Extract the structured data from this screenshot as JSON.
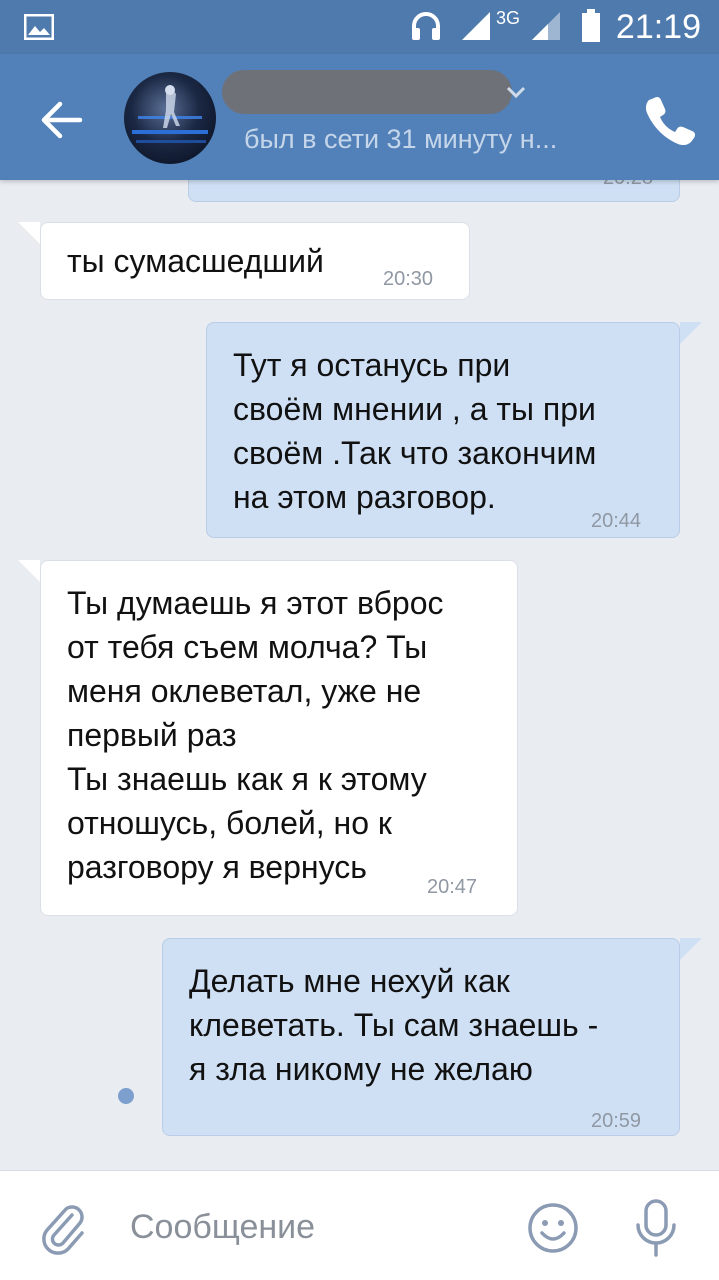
{
  "status_bar": {
    "network_type": "3G",
    "time": "21:19"
  },
  "header": {
    "contact_status": "был в сети 31 минуту н..."
  },
  "messages": [
    {
      "direction": "in",
      "text": "ты сумасшедший",
      "time": "20:30"
    },
    {
      "direction": "out",
      "text": "Тут я останусь при\nсвоём мнении , а ты при\nсвоём .Так что закончим\nна этом разговор.",
      "time": "20:44"
    },
    {
      "direction": "in",
      "text": "Ты думаешь я этот вброс\nот тебя съем молча?  Ты\nменя оклеветал, уже не\nпервый раз\nТы знаешь как я к этому\nотношусь, болей, но к\nразговору я вернусь",
      "time": "20:47"
    },
    {
      "direction": "out",
      "text": "Делать мне нехуй как\nклеветать. Ты сам знаешь -\nя зла никому не желаю",
      "time": "20:59"
    }
  ],
  "composer": {
    "placeholder": "Сообщение"
  },
  "colors": {
    "header": "#5181b8",
    "status_bar": "#4f7aad",
    "incoming_bubble": "#ffffff",
    "outgoing_bubble": "#cfe0f5",
    "chat_background": "#e9ecf1"
  }
}
